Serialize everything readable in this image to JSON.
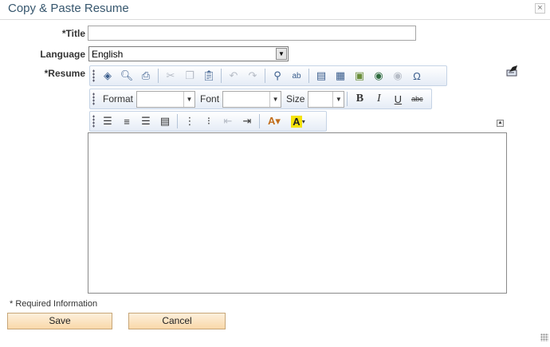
{
  "dialog": {
    "title": "Copy & Paste Resume",
    "close_glyph": "×"
  },
  "form": {
    "title_label": "*Title",
    "title_value": "",
    "language_label": "Language",
    "language_value": "English",
    "resume_label": "*Resume"
  },
  "toolbar": {
    "format_label": "Format",
    "font_label": "Font",
    "size_label": "Size",
    "format_value": "",
    "font_value": "",
    "size_value": "",
    "bold_glyph": "B",
    "italic_glyph": "I",
    "underline_glyph": "U",
    "strike_glyph": "abc",
    "icons": {
      "row1": [
        "source-icon",
        "preview-icon",
        "print-icon",
        "cut-icon",
        "copy-icon",
        "paste-icon",
        "undo-icon",
        "redo-icon",
        "find-icon",
        "spellcheck-icon",
        "horizontal-rule-icon",
        "table-icon",
        "image-icon",
        "link-icon",
        "unlink-icon",
        "special-char-icon"
      ],
      "row3": [
        "align-left-icon",
        "align-center-icon",
        "align-right-icon",
        "justify-icon",
        "numbered-list-icon",
        "bullet-list-icon",
        "outdent-icon",
        "indent-icon",
        "text-color-icon",
        "background-color-icon"
      ]
    }
  },
  "footer": {
    "required_note": "* Required Information",
    "save_label": "Save",
    "cancel_label": "Cancel"
  },
  "colors": {
    "title": "#37576e",
    "button_bg": "#f9d8a9",
    "toolbar_border": "#c5d3e5"
  }
}
